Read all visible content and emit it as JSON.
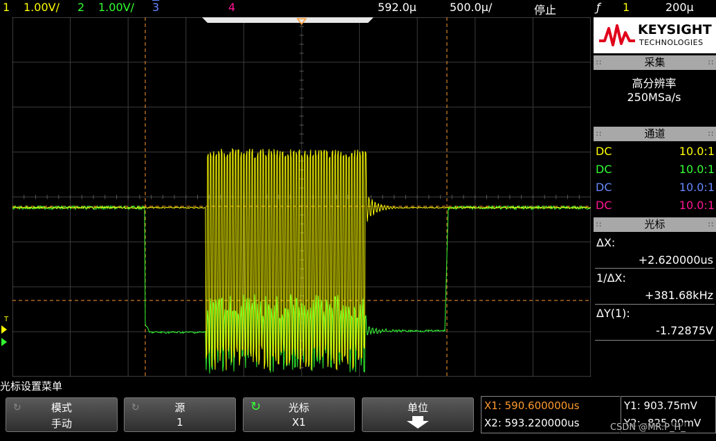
{
  "topbar": {
    "ch1_num": "1",
    "ch1_scale": "1.00V/",
    "ch2_num": "2",
    "ch2_scale": "1.00V/",
    "ch3_num": "3",
    "ch4_num": "4",
    "time_pos": "592.0µ",
    "time_scale": "500.0µ/",
    "run_state": "停止",
    "trigger_icon": "trigger-edge-icon",
    "trig_channel": "1",
    "trig_level": "200µ"
  },
  "panel": {
    "brand": "KEYSIGHT",
    "brand_sub": "TECHNOLOGIES",
    "acq_header": "采集",
    "acq_mode": "高分辨率",
    "acq_rate": "250MSa/s",
    "chan_header": "通道",
    "channels": [
      {
        "coupling": "DC",
        "probe": "10.0:1",
        "color": "#ffff00"
      },
      {
        "coupling": "DC",
        "probe": "10.0:1",
        "color": "#33ff33"
      },
      {
        "coupling": "DC",
        "probe": "10.0:1",
        "color": "#6688ff"
      },
      {
        "coupling": "DC",
        "probe": "10.0:1",
        "color": "#ff1493"
      }
    ],
    "cursor_header": "光标",
    "dx_label": "ΔX:",
    "dx_value": "+2.620000us",
    "inv_dx_label": "1/ΔX:",
    "inv_dx_value": "+381.68kHz",
    "dy_label": "ΔY(1):",
    "dy_value": "-1.72875V"
  },
  "menu": {
    "title": "光标设置菜单",
    "softkeys": [
      {
        "label": "模式",
        "value": "手动"
      },
      {
        "label": "源",
        "value": "1"
      },
      {
        "label": "光标",
        "value": "X1"
      },
      {
        "label": "单位",
        "value": ""
      }
    ],
    "x1": "X1: 590.600000us",
    "x2": "X2: 593.220000us",
    "y1": "Y1: 903.75mV",
    "y2": "Y2: -825.00mV"
  },
  "watermark": "CSDN @MR.P_H_",
  "colors": {
    "ch1": "#ffff00",
    "ch2": "#33ff33",
    "cursor": "#ff9a2e",
    "grid": "#505050"
  }
}
